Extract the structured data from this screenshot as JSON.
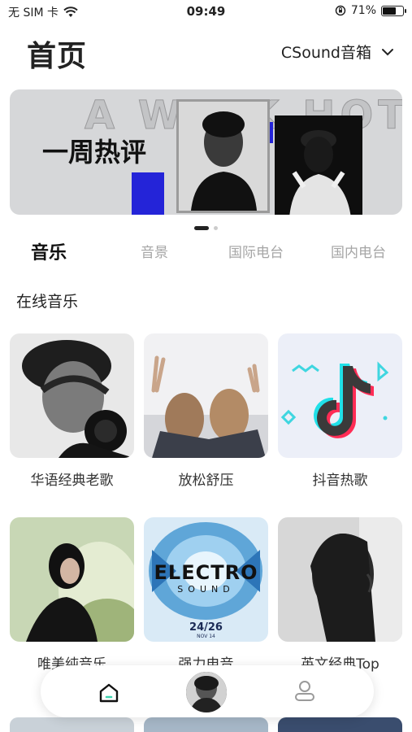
{
  "status_bar": {
    "carrier": "无 SIM 卡",
    "time": "09:49",
    "battery": "71%",
    "battery_level": 0.71
  },
  "header": {
    "title": "首页",
    "device": "CSound音箱"
  },
  "banner": {
    "title": "一周热评",
    "bg_text": "A WEEK HOT",
    "slides": 2,
    "active_slide": 0
  },
  "tabs": [
    {
      "label": "音乐",
      "active": true
    },
    {
      "label": "音景",
      "active": false
    },
    {
      "label": "国际电台",
      "active": false
    },
    {
      "label": "国内电台",
      "active": false
    }
  ],
  "section": {
    "title": "在线音乐"
  },
  "cards": [
    {
      "label": "华语经典老歌",
      "icon": "headphones-man-photo"
    },
    {
      "label": "放松舒压",
      "icon": "friends-peace-photo"
    },
    {
      "label": "抖音热歌",
      "icon": "tiktok-icon"
    },
    {
      "label": "唯美纯音乐",
      "icon": "woman-smoke-photo"
    },
    {
      "label": "强力电音",
      "icon": "electro-sound-poster",
      "poster_title": "ELECTRO",
      "poster_sub": "SOUND",
      "poster_date": "24/26",
      "poster_month": "NOV 14"
    },
    {
      "label": "英文经典Top",
      "icon": "woman-silhouette-photo"
    }
  ],
  "bottom_nav": {
    "home": "home-icon",
    "player": "now-playing-avatar",
    "profile": "user-icon"
  },
  "colors": {
    "accent": "#7fe3c8",
    "banner_blue": "#2424d8"
  }
}
